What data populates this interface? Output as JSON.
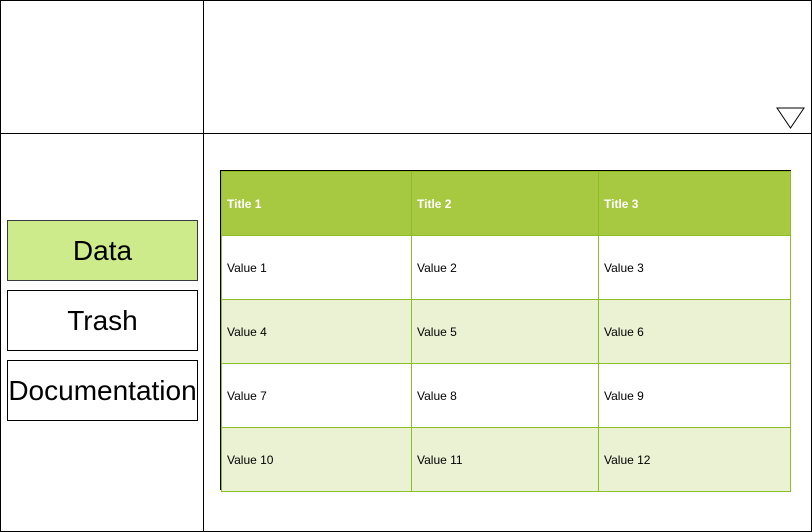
{
  "nav": {
    "items": [
      {
        "label": "Data",
        "active": true
      },
      {
        "label": "Trash",
        "active": false
      },
      {
        "label": "Documentation",
        "active": false
      }
    ]
  },
  "header": {
    "dropdown_icon": "triangle-down-icon"
  },
  "table": {
    "headers": [
      "Title 1",
      "Title 2",
      "Title 3"
    ],
    "rows": [
      [
        "Value 1",
        "Value 2",
        "Value 3"
      ],
      [
        "Value 4",
        "Value 5",
        "Value 6"
      ],
      [
        "Value 7",
        "Value 8",
        "Value 9"
      ],
      [
        "Value 10",
        "Value 11",
        "Value 12"
      ]
    ]
  },
  "colors": {
    "header_bg": "#a7c942",
    "active_nav_bg": "#cdeb8b",
    "alt_row_bg": "#eaf2d3",
    "grid_line": "#8cbf26"
  }
}
